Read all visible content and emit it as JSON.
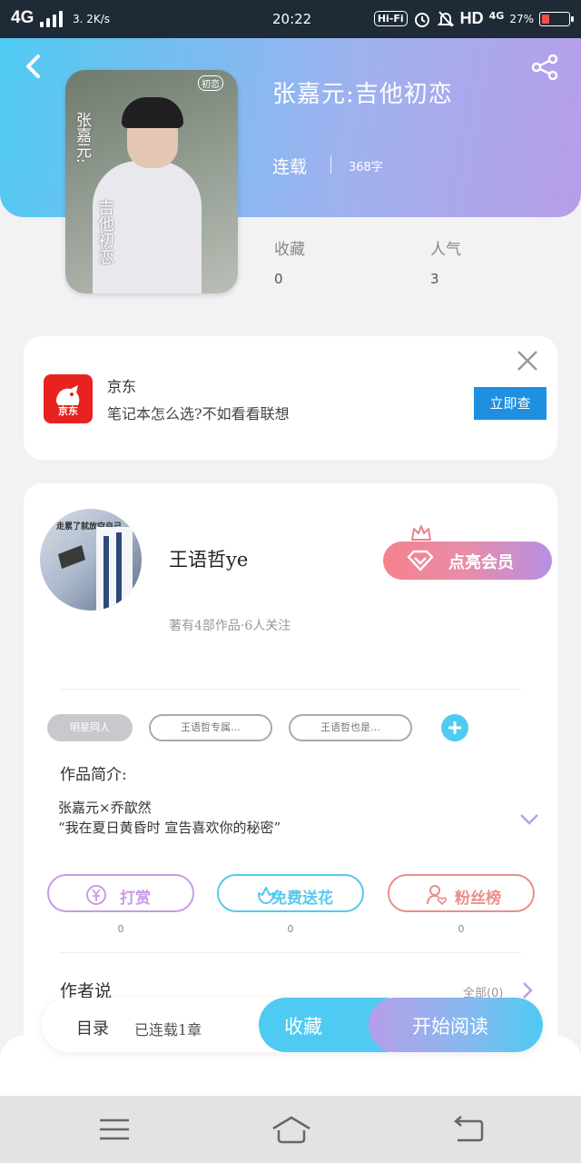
{
  "status_bar": {
    "network": "4G",
    "speed": "3. 2K/s",
    "time": "20:22",
    "hifi": "Hi-Fi",
    "hd": "HD",
    "mobile_data": "4G",
    "battery_percent": "27%",
    "battery_level": 0.27
  },
  "book": {
    "title": "张嘉元:吉他初恋",
    "status": "连载",
    "word_count": "368字",
    "cover_text_1": "张嘉元:",
    "cover_text_2": "吉他初恋",
    "cover_badge": "初恋"
  },
  "stats": {
    "favorites_label": "收藏",
    "favorites_value": "0",
    "popularity_label": "人气",
    "popularity_value": "3"
  },
  "ad": {
    "brand": "京东",
    "logo_text": "京东",
    "description": "笔记本怎么选?不如看看联想",
    "cta": "立即查"
  },
  "author": {
    "name": "王语哲ye",
    "meta": "著有4部作品·6人关注",
    "avatar_text": "走累了就放空自己",
    "vip_button": "点亮会员"
  },
  "tags": [
    "明星同人",
    "王语哲专属…",
    "王语哲也是…"
  ],
  "intro": {
    "label": "作品简介:",
    "line1": "张嘉元×乔歆然",
    "line2": "“我在夏日黄昏时 宣告喜欢你的秘密”"
  },
  "actions": [
    {
      "label": "打赏",
      "count": "0",
      "color": "#c89be6"
    },
    {
      "label": "免费送花",
      "count": "0",
      "color": "#56c9ee"
    },
    {
      "label": "粉丝榜",
      "count": "0",
      "color": "#e98f8a"
    }
  ],
  "author_said": {
    "label": "作者说",
    "all": "全部(0)"
  },
  "bottom_bar": {
    "toc": "目录",
    "toc_sub": "已连载1章",
    "favorite": "收藏",
    "start_reading": "开始阅读"
  },
  "colors": {
    "accent_blue": "#4fcaf2",
    "accent_purple": "#b79ee9",
    "jd_red": "#e8231f",
    "cta_blue": "#1f8fe0"
  }
}
